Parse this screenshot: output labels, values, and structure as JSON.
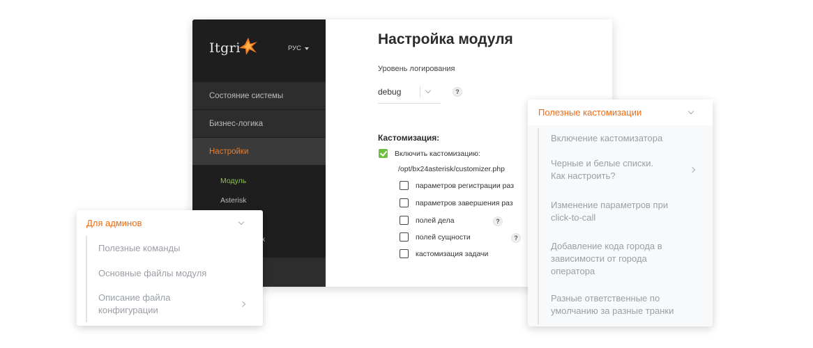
{
  "app": {
    "logo_text": "Itgri",
    "lang": "РУС",
    "nav": [
      {
        "label": "Состояние системы"
      },
      {
        "label": "Бизнес-логика"
      },
      {
        "label": "Настройки"
      }
    ],
    "subnav": [
      {
        "label": "Модуль"
      },
      {
        "label": "Asterisk"
      },
      {
        "label": "х"
      }
    ],
    "accent": "#f47a1f",
    "active_sub_color": "#8bc34a"
  },
  "main": {
    "title": "Настройка модуля",
    "log_level_label": "Уровень логирования",
    "log_level_value": "debug",
    "help_glyph": "?",
    "customization_title": "Кастомизация:",
    "enable_label": "Включить кастомизацию:",
    "path": "/opt/bx24asterisk/customizer.php",
    "options": [
      {
        "label": "параметров регистрации раз",
        "checked": false
      },
      {
        "label": "параметров завершения раз",
        "checked": false
      },
      {
        "label": "полей дела",
        "checked": false
      },
      {
        "label": "полей сущности",
        "checked": false
      },
      {
        "label": "кастомизация задачи",
        "checked": false
      }
    ]
  },
  "admins_panel": {
    "title": "Для админов",
    "items": [
      {
        "label": "Полезные команды"
      },
      {
        "label": "Основные файлы модуля"
      },
      {
        "label_line1": "Описание файла",
        "label_line2": "конфигурации"
      }
    ]
  },
  "custom_panel": {
    "title": "Полезные кастомизации",
    "items": [
      {
        "label": "Включение кастомизатора"
      },
      {
        "label_line1": "Черные и белые списки.",
        "label_line2": "Как настроить?"
      },
      {
        "label_line1": "Изменение параметров при",
        "label_line2": "click-to-call"
      },
      {
        "label_line1": "Добавление кода города в",
        "label_line2": "зависимости от города",
        "label_line3": "оператора"
      },
      {
        "label_line1": "Разные ответственные по",
        "label_line2": "умолчанию за разные транки"
      }
    ]
  },
  "colors": {
    "panel_header": "#ee6a12",
    "checkbox_checked": "#6fbf3f",
    "sidebar_bg": "#1e1e1e"
  }
}
